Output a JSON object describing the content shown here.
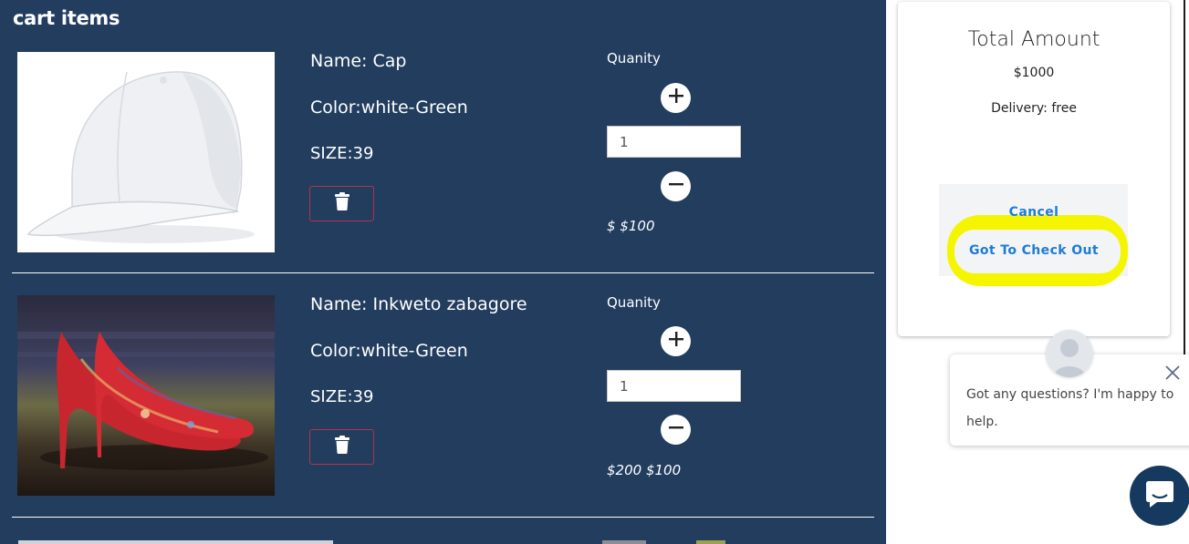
{
  "cart": {
    "title": "cart items",
    "items": [
      {
        "name_label": "Name:",
        "name": "Cap",
        "color": "Color:white-Green",
        "size": "SIZE:39",
        "quantity_label": "Quanity",
        "quantity": "1",
        "price": "$ $100",
        "image": "white-baseball-cap"
      },
      {
        "name_label": "Name:",
        "name": "Inkweto zabagore",
        "color": "Color:white-Green",
        "size": "SIZE:39",
        "quantity_label": "Quanity",
        "quantity": "1",
        "price": "$200 $100",
        "image": "red-floral-high-heels"
      }
    ],
    "icons": {
      "delete": "trash-icon",
      "increase": "plus-icon",
      "decrease": "minus-icon"
    }
  },
  "summary": {
    "title": "Total Amount",
    "amount": "$1000",
    "delivery": "Delivery: free",
    "cancel_label": "Cancel",
    "checkout_label": "Got To Check Out"
  },
  "chat": {
    "message": "Got any questions? I'm happy to help.",
    "icons": {
      "close": "close-icon",
      "avatar": "user-avatar-icon",
      "launcher": "chat-bubble-icon"
    }
  },
  "colors": {
    "panel_bg": "#223d5e",
    "link": "#1e7cd6",
    "highlight": "#f5f500",
    "delete_border": "#b0344d",
    "launcher": "#163a5f"
  }
}
